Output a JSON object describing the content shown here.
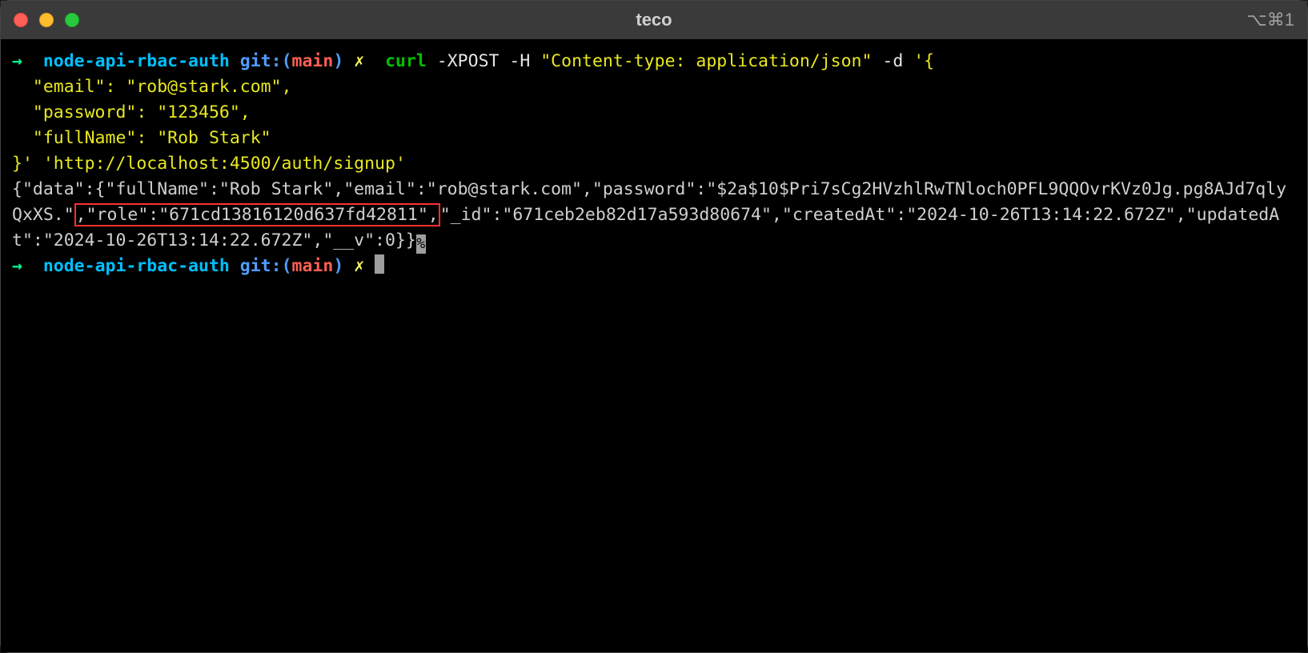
{
  "window": {
    "title": "teco",
    "shortcut": "⌥⌘1"
  },
  "prompt1": {
    "arrow": "→",
    "path": "node-api-rbac-auth",
    "git_label": "git:(",
    "branch": "main",
    "git_close": ")",
    "dirty": "✗",
    "cmd": "curl",
    "args": " -XPOST -H ",
    "hdr": "\"Content-type: application/json\"",
    "d_flag": " -d ",
    "body_open": "'{",
    "body_l1": "  \"email\": \"rob@stark.com\",",
    "body_l2": "  \"password\": \"123456\",",
    "body_l3": "  \"fullName\": \"Rob Stark\"",
    "body_close": "}'",
    "url": "'http://localhost:4500/auth/signup'"
  },
  "output": {
    "pre": "{\"data\":{\"fullName\":\"Rob Stark\",\"email\":\"rob@stark.com\",\"password\":\"$2a$10$Pri7sCg2HVzhlRwTNloch0PFL9QQOvrKVz0Jg.pg8AJd7qlyQxXS.\"",
    "highlight": ",\"role\":\"671cd13816120d637fd42811\",",
    "post": "\"_id\":\"671ceb2eb82d17a593d80674\",\"createdAt\":\"2024-10-26T13:14:22.672Z\",\"updatedAt\":\"2024-10-26T13:14:22.672Z\",\"__v\":0}}",
    "endmark": "%"
  },
  "prompt2": {
    "arrow": "→",
    "path": "node-api-rbac-auth",
    "git_label": "git:(",
    "branch": "main",
    "git_close": ")",
    "dirty": "✗"
  }
}
